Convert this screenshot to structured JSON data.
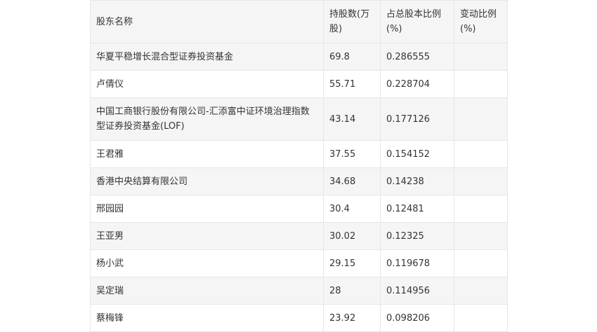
{
  "table": {
    "headers": [
      "股东名称",
      "持股数(万股)",
      "占总股本比例(%)",
      "变动比例(%)"
    ],
    "rows": [
      {
        "name": "华夏平稳增长混合型证券投资基金",
        "shares": "69.8",
        "ratio": "0.286555",
        "change": ""
      },
      {
        "name": "卢倩仪",
        "shares": "55.71",
        "ratio": "0.228704",
        "change": ""
      },
      {
        "name": "中国工商银行股份有限公司-汇添富中证环境治理指数型证券投资基金(LOF)",
        "shares": "43.14",
        "ratio": "0.177126",
        "change": ""
      },
      {
        "name": "王君雅",
        "shares": "37.55",
        "ratio": "0.154152",
        "change": ""
      },
      {
        "name": "香港中央结算有限公司",
        "shares": "34.68",
        "ratio": "0.14238",
        "change": ""
      },
      {
        "name": "邢园园",
        "shares": "30.4",
        "ratio": "0.12481",
        "change": ""
      },
      {
        "name": "王亚男",
        "shares": "30.02",
        "ratio": "0.12325",
        "change": ""
      },
      {
        "name": "杨小武",
        "shares": "29.15",
        "ratio": "0.119678",
        "change": ""
      },
      {
        "name": "吴定瑞",
        "shares": "28",
        "ratio": "0.114956",
        "change": ""
      },
      {
        "name": "蔡梅锋",
        "shares": "23.92",
        "ratio": "0.098206",
        "change": ""
      }
    ]
  }
}
